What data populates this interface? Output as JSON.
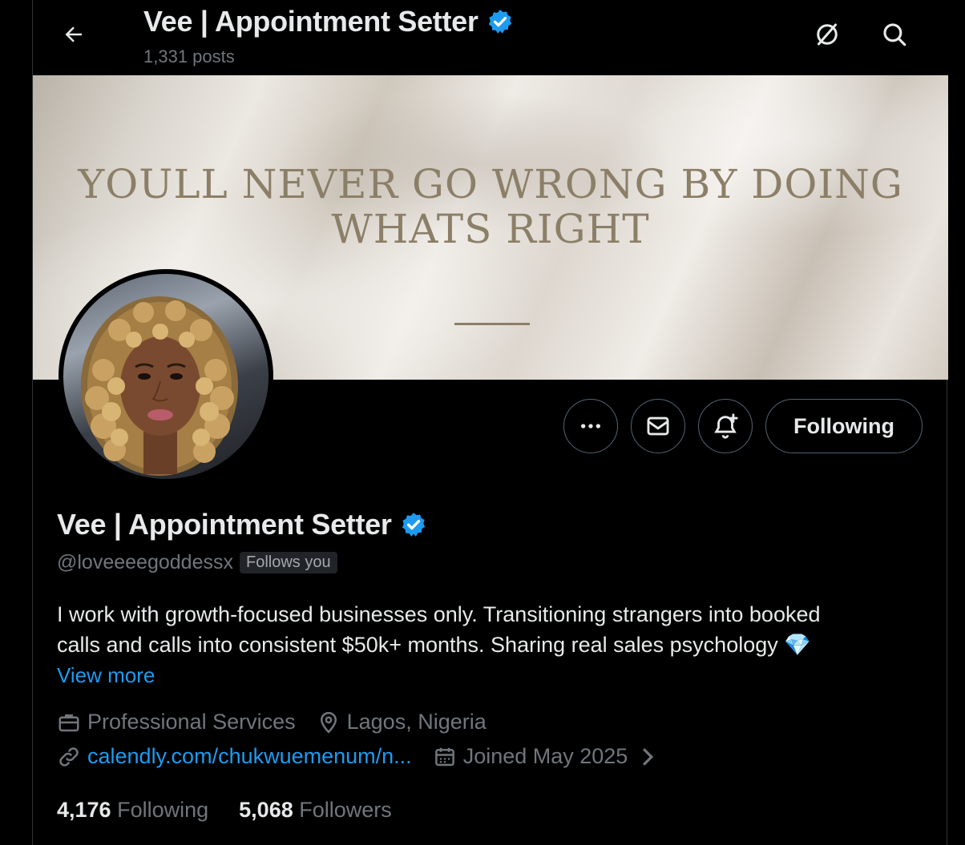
{
  "header": {
    "title": "Vee | Appointment Setter",
    "post_count": "1,331 posts"
  },
  "banner": {
    "quote_line1": "YOULL NEVER GO WRONG BY DOING",
    "quote_line2": "WHATS RIGHT"
  },
  "actions": {
    "following_label": "Following"
  },
  "profile": {
    "name": "Vee | Appointment Setter",
    "handle": "@loveeeegoddessx",
    "follows_you": "Follows you",
    "bio_line1": "I work with growth-focused businesses only. Transitioning strangers into booked",
    "bio_line2": "calls and calls into consistent $50k+ months. Sharing real sales psychology 💎",
    "view_more": "View more",
    "category": "Professional Services",
    "location": "Lagos, Nigeria",
    "website": "calendly.com/chukwuemenum/n...",
    "joined": "Joined May 2025"
  },
  "stats": {
    "following_count": "4,176",
    "following_label": "Following",
    "followers_count": "5,068",
    "followers_label": "Followers"
  },
  "colors": {
    "accent": "#1d9bf0",
    "muted_text": "#71767b",
    "background": "#000000"
  }
}
